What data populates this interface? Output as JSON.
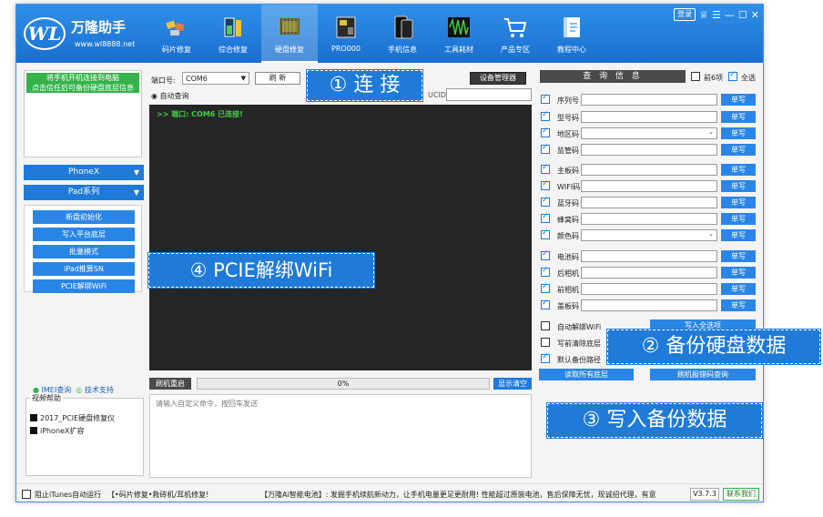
{
  "app": {
    "name": "万隆助手",
    "url": "www.wl8888.net",
    "logo_text": "WL"
  },
  "nav": [
    {
      "label": "码片修复",
      "icon": "chip-icon"
    },
    {
      "label": "综合修复",
      "icon": "battery-icon"
    },
    {
      "label": "硬盘修复",
      "icon": "harddisk-icon"
    },
    {
      "label": "PRO000",
      "icon": "board-icon"
    },
    {
      "label": "手机信息",
      "icon": "phone-icon"
    },
    {
      "label": "工具耗材",
      "icon": "waveform-icon"
    },
    {
      "label": "产品专区",
      "icon": "cart-icon"
    },
    {
      "label": "教程中心",
      "icon": "book-icon"
    }
  ],
  "window_controls": {
    "login": "登录",
    "shirt": "♕",
    "menu": "☰",
    "min": "—",
    "max": "☐",
    "close": "✕"
  },
  "left": {
    "notice": "将手机开机连接到电脑\n点击信任后可备份硬盘底层信息",
    "dropdown1": "PhoneX",
    "dropdown2": "Pad系列",
    "buttons": [
      "新盘初始化",
      "写入平台底层",
      "批量模式",
      "iPad推算SN",
      "PCIE解绑WiFi"
    ],
    "link1": "IMEI查询",
    "link2": "技术支持",
    "video_title": "视频帮助",
    "videos": [
      "2017_PCIE硬盘修复仪",
      "iPhoneX扩容"
    ]
  },
  "center": {
    "port_label": "端口号:",
    "port_value": "COM6",
    "refresh": "刷 新",
    "device_mgr": "设备管理器",
    "auto_query": "自动查询",
    "ucid_label": "UCID",
    "console_line": ">> 端口: COM6 已连接!",
    "flash_reboot": "刷机重启",
    "progress": "0%",
    "progress_fraction": 0,
    "clear_btn": "显示清空",
    "cmd_placeholder": "请输入自定义命令，按回车发送"
  },
  "right": {
    "query": "查 询 信 息",
    "prev": "前6项",
    "all": "全选",
    "fields": [
      {
        "label": "序列号",
        "btn": "单写"
      },
      {
        "label": "型号码",
        "btn": "单写"
      },
      {
        "label": "地区码",
        "btn": "单写"
      },
      {
        "label": "监管码",
        "btn": "单写"
      },
      {
        "label": "主板码",
        "btn": "单写"
      },
      {
        "label": "WIFI码",
        "btn": "单写"
      },
      {
        "label": "蓝牙码",
        "btn": "单写"
      },
      {
        "label": "蜂窝码",
        "btn": "单写"
      },
      {
        "label": "颜色码",
        "btn": "单写"
      },
      {
        "label": "电池码",
        "btn": "单写"
      },
      {
        "label": "后相机",
        "btn": "单写"
      },
      {
        "label": "前相机",
        "btn": "单写"
      },
      {
        "label": "盖板码",
        "btn": "单写"
      }
    ],
    "opt1": "自动解绑WiFi",
    "opt2": "写前清除底层",
    "opt3": "默认备份路径",
    "write_all": "写入全选项",
    "read_all": "读取所有底层",
    "flash_query": "刷机报错码查询"
  },
  "statusbar": {
    "itunes": "阻止iTunes自动运行",
    "slogan1": "【•码片修复•救砖机/耳机修复!",
    "slogan2": "【万隆Ai智能电池】: 发掘手机续航新动力，让手机电量更足更耐用! 性能超过原装电池，售后保障无忧，现诚招代理，有意",
    "version": "V3.7.3",
    "contact": "联系我们"
  },
  "overlays": {
    "connect": "① 连 接",
    "backup": "② 备份硬盘数据",
    "write": "③ 写入备份数据",
    "pcie": "④ PCIE解绑WiFi"
  }
}
